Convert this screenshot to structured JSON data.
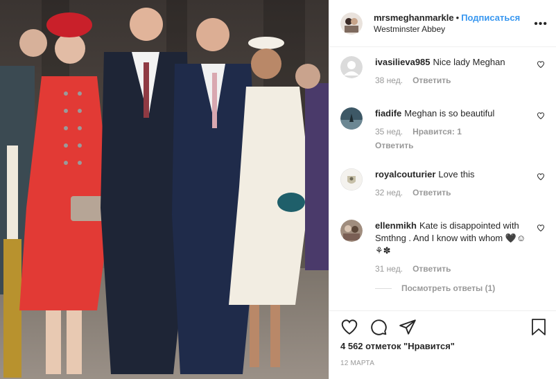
{
  "colors": {
    "link": "#3897f0",
    "meta": "#999999",
    "border": "#efefef"
  },
  "header": {
    "username": "mrsmeghanmarkle",
    "separator": "•",
    "follow_label": "Подписаться",
    "location": "Westminster Abbey",
    "more_icon": "more-horizontal-icon"
  },
  "comments": [
    {
      "user": "ivasilieva985",
      "text": "Nice lady Meghan",
      "age": "38 нед.",
      "likes": "",
      "reply_label": "Ответить"
    },
    {
      "user": "fiadife",
      "text": "Meghan is so beautiful",
      "age": "35 нед.",
      "likes": "Нравится: 1",
      "reply_label": "Ответить"
    },
    {
      "user": "royalcouturier",
      "text": "Love this",
      "age": "32 нед.",
      "likes": "",
      "reply_label": "Ответить"
    },
    {
      "user": "ellenmikh",
      "text": "Kate is disappointed with Smthng . And I know with whom 🖤☺⚘✽",
      "age": "31 нед.",
      "likes": "",
      "reply_label": "Ответить",
      "view_replies": "Посмотреть ответы (1)"
    }
  ],
  "actions": {
    "icons": [
      "heart-icon",
      "comment-icon",
      "share-icon",
      "bookmark-icon"
    ],
    "likes": "4 562 отметок \"Нравится\"",
    "date": "12 МАРТА"
  }
}
